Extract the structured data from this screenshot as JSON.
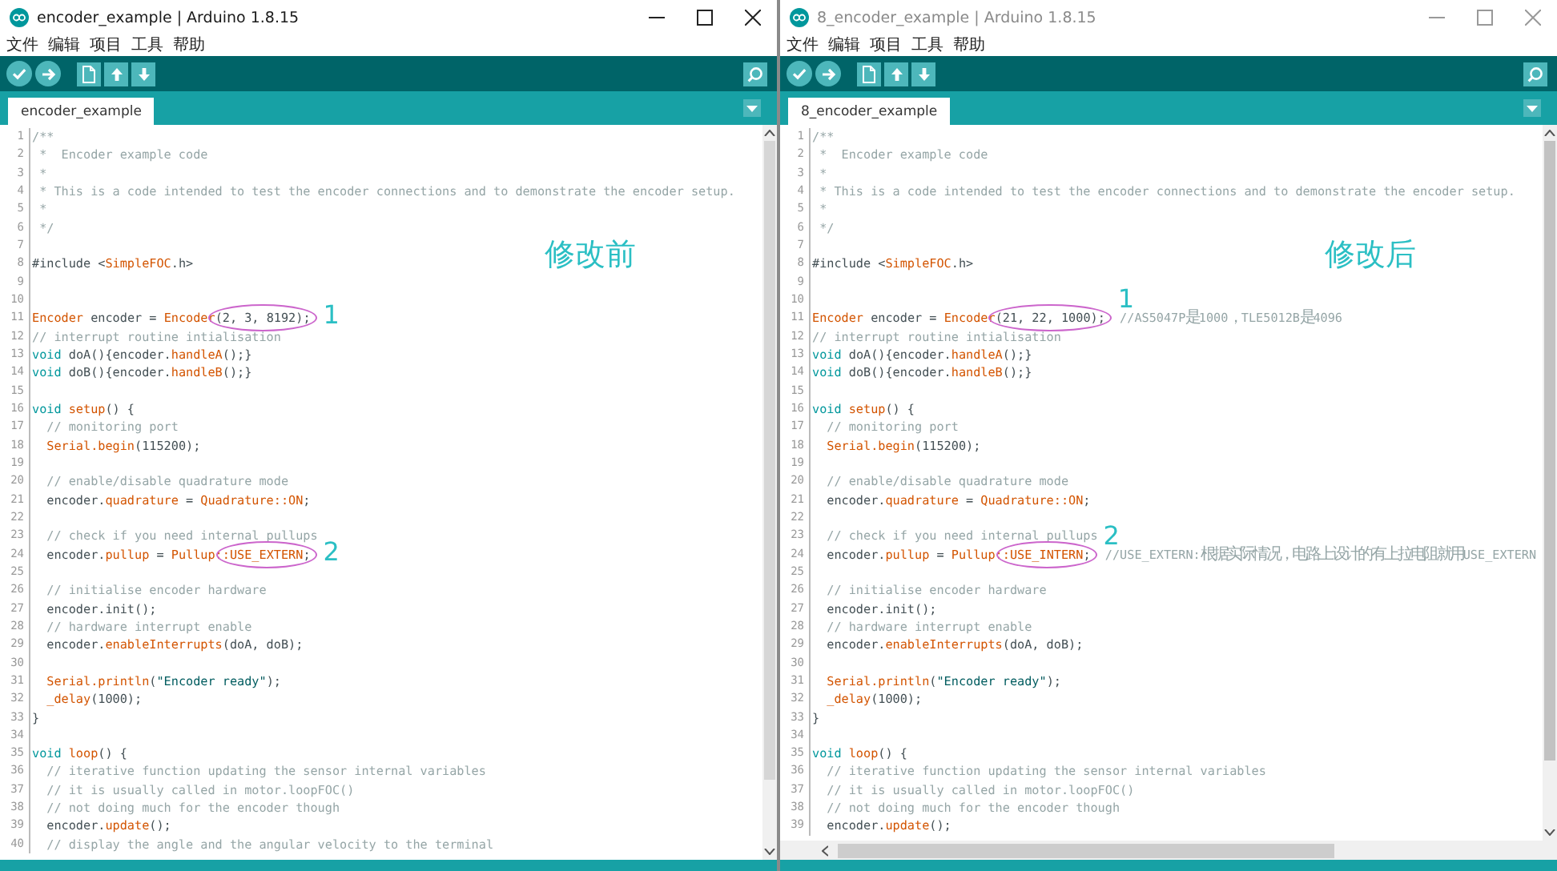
{
  "windows": [
    {
      "title": "encoder_example | Arduino 1.8.15",
      "active": true,
      "menu": [
        "文件",
        "编辑",
        "项目",
        "工具",
        "帮助"
      ],
      "tabs": [
        {
          "label": "encoder_example",
          "selected": true
        }
      ],
      "note": "修改前",
      "horizontal_scrollbar": false,
      "lines": [
        {
          "n": "1",
          "segs": [
            {
              "t": "/**",
              "kind": "cm"
            }
          ]
        },
        {
          "n": "2",
          "segs": [
            {
              "t": " *  Encoder example code",
              "kind": "cm"
            }
          ]
        },
        {
          "n": "3",
          "segs": [
            {
              "t": " *",
              "kind": "cm"
            }
          ]
        },
        {
          "n": "4",
          "segs": [
            {
              "t": " * This is a code intended to test the encoder connections and to demonstrate the encoder setup.",
              "kind": "cm"
            }
          ]
        },
        {
          "n": "5",
          "segs": [
            {
              "t": " *",
              "kind": "cm"
            }
          ]
        },
        {
          "n": "6",
          "segs": [
            {
              "t": " */",
              "kind": "cm"
            }
          ]
        },
        {
          "n": "7"
        },
        {
          "n": "8",
          "segs": [
            {
              "t": "#include <",
              "kind": "plain"
            },
            {
              "t": "SimpleFOC",
              "kind": "fn"
            },
            {
              "t": ".h>",
              "kind": "plain"
            }
          ]
        },
        {
          "n": "9"
        },
        {
          "n": "10"
        },
        {
          "n": "11",
          "mark": "1",
          "segs": [
            {
              "t": "Encoder",
              "kind": "fn"
            },
            {
              "t": " encoder = ",
              "kind": "plain"
            },
            {
              "t": "Encoder",
              "kind": "fn"
            },
            {
              "t": "(2, 3, 8192);",
              "kind": "plain",
              "circled": true
            }
          ]
        },
        {
          "n": "12",
          "segs": [
            {
              "t": "// interrupt routine intialisation",
              "kind": "cm"
            }
          ]
        },
        {
          "n": "13",
          "segs": [
            {
              "t": "void",
              "kind": "kw"
            },
            {
              "t": " doA(){encoder.",
              "kind": "plain"
            },
            {
              "t": "handleA",
              "kind": "fn"
            },
            {
              "t": "();}",
              "kind": "plain"
            }
          ]
        },
        {
          "n": "14",
          "segs": [
            {
              "t": "void",
              "kind": "kw"
            },
            {
              "t": " doB(){encoder.",
              "kind": "plain"
            },
            {
              "t": "handleB",
              "kind": "fn"
            },
            {
              "t": "();}",
              "kind": "plain"
            }
          ]
        },
        {
          "n": "15"
        },
        {
          "n": "16",
          "segs": [
            {
              "t": "void ",
              "kind": "kw"
            },
            {
              "t": "setup",
              "kind": "fn"
            },
            {
              "t": "() {",
              "kind": "plain"
            }
          ]
        },
        {
          "n": "17",
          "segs": [
            {
              "t": "  // monitoring port",
              "kind": "cm"
            }
          ]
        },
        {
          "n": "18",
          "segs": [
            {
              "t": "  Serial.begin",
              "kind": "fn"
            },
            {
              "t": "(115200);",
              "kind": "plain"
            }
          ]
        },
        {
          "n": "19"
        },
        {
          "n": "20",
          "segs": [
            {
              "t": "  // enable/disable quadrature mode",
              "kind": "cm"
            }
          ]
        },
        {
          "n": "21",
          "segs": [
            {
              "t": "  encoder.",
              "kind": "plain"
            },
            {
              "t": "quadrature",
              "kind": "fn"
            },
            {
              "t": " = ",
              "kind": "plain"
            },
            {
              "t": "Quadrature::ON",
              "kind": "fn"
            },
            {
              "t": ";",
              "kind": "plain"
            }
          ]
        },
        {
          "n": "22"
        },
        {
          "n": "23",
          "segs": [
            {
              "t": "  // check if you need internal pullups",
              "kind": "cm"
            }
          ]
        },
        {
          "n": "24",
          "mark": "2",
          "segs": [
            {
              "t": "  encoder.",
              "kind": "plain"
            },
            {
              "t": "pullup",
              "kind": "fn"
            },
            {
              "t": " = ",
              "kind": "plain"
            },
            {
              "t": "Pullup:",
              "kind": "fn"
            },
            {
              "t": ":USE_EXTERN",
              "kind": "fn",
              "circled": true
            },
            {
              "t": ";",
              "kind": "plain",
              "circled": true
            }
          ]
        },
        {
          "n": "25"
        },
        {
          "n": "26",
          "segs": [
            {
              "t": "  // initialise encoder hardware",
              "kind": "cm"
            }
          ]
        },
        {
          "n": "27",
          "segs": [
            {
              "t": "  encoder.init();",
              "kind": "plain"
            }
          ]
        },
        {
          "n": "28",
          "segs": [
            {
              "t": "  // hardware interrupt enable",
              "kind": "cm"
            }
          ]
        },
        {
          "n": "29",
          "segs": [
            {
              "t": "  encoder.",
              "kind": "plain"
            },
            {
              "t": "enableInterrupts",
              "kind": "fn"
            },
            {
              "t": "(doA, doB);",
              "kind": "plain"
            }
          ]
        },
        {
          "n": "30"
        },
        {
          "n": "31",
          "segs": [
            {
              "t": "  Serial.println",
              "kind": "fn"
            },
            {
              "t": "(",
              "kind": "plain"
            },
            {
              "t": "\"Encoder ready\"",
              "kind": "str"
            },
            {
              "t": ");",
              "kind": "plain"
            }
          ]
        },
        {
          "n": "32",
          "segs": [
            {
              "t": "  _delay",
              "kind": "fn"
            },
            {
              "t": "(1000);",
              "kind": "plain"
            }
          ]
        },
        {
          "n": "33",
          "segs": [
            {
              "t": "}",
              "kind": "plain"
            }
          ]
        },
        {
          "n": "34"
        },
        {
          "n": "35",
          "segs": [
            {
              "t": "void ",
              "kind": "kw"
            },
            {
              "t": "loop",
              "kind": "fn"
            },
            {
              "t": "() {",
              "kind": "plain"
            }
          ]
        },
        {
          "n": "36",
          "segs": [
            {
              "t": "  // iterative function updating the sensor internal variables",
              "kind": "cm"
            }
          ]
        },
        {
          "n": "37",
          "segs": [
            {
              "t": "  // it is usually called in motor.loopFOC()",
              "kind": "cm"
            }
          ]
        },
        {
          "n": "38",
          "segs": [
            {
              "t": "  // not doing much for the encoder though",
              "kind": "cm"
            }
          ]
        },
        {
          "n": "39",
          "segs": [
            {
              "t": "  encoder.",
              "kind": "plain"
            },
            {
              "t": "update",
              "kind": "fn"
            },
            {
              "t": "();",
              "kind": "plain"
            }
          ]
        },
        {
          "n": "40",
          "segs": [
            {
              "t": "  // display the angle and the angular velocity to the terminal",
              "kind": "cm"
            }
          ]
        }
      ]
    },
    {
      "title": "8_encoder_example | Arduino 1.8.15",
      "active": false,
      "menu": [
        "文件",
        "编辑",
        "项目",
        "工具",
        "帮助"
      ],
      "tabs": [
        {
          "label": "8_encoder_example",
          "selected": true
        }
      ],
      "note": "修改后",
      "horizontal_scrollbar": true,
      "lines": [
        {
          "n": "1",
          "segs": [
            {
              "t": "/**",
              "kind": "cm"
            }
          ]
        },
        {
          "n": "2",
          "segs": [
            {
              "t": " *  Encoder example code",
              "kind": "cm"
            }
          ]
        },
        {
          "n": "3",
          "segs": [
            {
              "t": " *",
              "kind": "cm"
            }
          ]
        },
        {
          "n": "4",
          "segs": [
            {
              "t": " * This is a code intended to test the encoder connections and to demonstrate the encoder setup.",
              "kind": "cm"
            }
          ]
        },
        {
          "n": "5",
          "segs": [
            {
              "t": " *",
              "kind": "cm"
            }
          ]
        },
        {
          "n": "6",
          "segs": [
            {
              "t": " */",
              "kind": "cm"
            }
          ]
        },
        {
          "n": "7"
        },
        {
          "n": "8",
          "segs": [
            {
              "t": "#include <",
              "kind": "plain"
            },
            {
              "t": "SimpleFOC",
              "kind": "fn"
            },
            {
              "t": ".h>",
              "kind": "plain"
            }
          ]
        },
        {
          "n": "9"
        },
        {
          "n": "10"
        },
        {
          "n": "11",
          "mark": "1",
          "segs": [
            {
              "t": "Encoder",
              "kind": "fn"
            },
            {
              "t": " encoder = ",
              "kind": "plain"
            },
            {
              "t": "Encoder",
              "kind": "fn"
            },
            {
              "t": "(21, 22, 1000);",
              "kind": "plain",
              "circled": true
            },
            {
              "t": "  //AS5047P",
              "kind": "cm"
            },
            {
              "t": "是",
              "kind": "cjk"
            },
            {
              "t": "1000",
              "kind": "cm"
            },
            {
              "t": "，",
              "kind": "cjk"
            },
            {
              "t": "TLE5012B",
              "kind": "cm"
            },
            {
              "t": "是",
              "kind": "cjk"
            },
            {
              "t": "4096",
              "kind": "cm"
            }
          ]
        },
        {
          "n": "12",
          "segs": [
            {
              "t": "// interrupt routine intialisation",
              "kind": "cm"
            }
          ]
        },
        {
          "n": "13",
          "segs": [
            {
              "t": "void",
              "kind": "kw"
            },
            {
              "t": " doA(){encoder.",
              "kind": "plain"
            },
            {
              "t": "handleA",
              "kind": "fn"
            },
            {
              "t": "();}",
              "kind": "plain"
            }
          ]
        },
        {
          "n": "14",
          "segs": [
            {
              "t": "void",
              "kind": "kw"
            },
            {
              "t": " doB(){encoder.",
              "kind": "plain"
            },
            {
              "t": "handleB",
              "kind": "fn"
            },
            {
              "t": "();}",
              "kind": "plain"
            }
          ]
        },
        {
          "n": "15"
        },
        {
          "n": "16",
          "segs": [
            {
              "t": "void ",
              "kind": "kw"
            },
            {
              "t": "setup",
              "kind": "fn"
            },
            {
              "t": "() {",
              "kind": "plain"
            }
          ]
        },
        {
          "n": "17",
          "segs": [
            {
              "t": "  // monitoring port",
              "kind": "cm"
            }
          ]
        },
        {
          "n": "18",
          "segs": [
            {
              "t": "  Serial.begin",
              "kind": "fn"
            },
            {
              "t": "(115200);",
              "kind": "plain"
            }
          ]
        },
        {
          "n": "19"
        },
        {
          "n": "20",
          "segs": [
            {
              "t": "  // enable/disable quadrature mode",
              "kind": "cm"
            }
          ]
        },
        {
          "n": "21",
          "segs": [
            {
              "t": "  encoder.",
              "kind": "plain"
            },
            {
              "t": "quadrature",
              "kind": "fn"
            },
            {
              "t": " = ",
              "kind": "plain"
            },
            {
              "t": "Quadrature::ON",
              "kind": "fn"
            },
            {
              "t": ";",
              "kind": "plain"
            }
          ]
        },
        {
          "n": "22"
        },
        {
          "n": "23",
          "segs": [
            {
              "t": "  // check if you need internal pullups",
              "kind": "cm"
            }
          ]
        },
        {
          "n": "24",
          "mark": "2",
          "segs": [
            {
              "t": "  encoder.",
              "kind": "plain"
            },
            {
              "t": "pullup",
              "kind": "fn"
            },
            {
              "t": " = ",
              "kind": "plain"
            },
            {
              "t": "Pullup:",
              "kind": "fn"
            },
            {
              "t": ":USE_INTERN",
              "kind": "fn",
              "circled": true
            },
            {
              "t": ";",
              "kind": "plain",
              "circled": true
            },
            {
              "t": "  //USE_EXTERN:",
              "kind": "cm"
            },
            {
              "t": "根据实际情况，电路上设计的有上拉电阻就用",
              "kind": "cjk"
            },
            {
              "t": "USE_EXTERN",
              "kind": "cm"
            }
          ]
        },
        {
          "n": "25"
        },
        {
          "n": "26",
          "segs": [
            {
              "t": "  // initialise encoder hardware",
              "kind": "cm"
            }
          ]
        },
        {
          "n": "27",
          "segs": [
            {
              "t": "  encoder.init();",
              "kind": "plain"
            }
          ]
        },
        {
          "n": "28",
          "segs": [
            {
              "t": "  // hardware interrupt enable",
              "kind": "cm"
            }
          ]
        },
        {
          "n": "29",
          "segs": [
            {
              "t": "  encoder.",
              "kind": "plain"
            },
            {
              "t": "enableInterrupts",
              "kind": "fn"
            },
            {
              "t": "(doA, doB);",
              "kind": "plain"
            }
          ]
        },
        {
          "n": "30"
        },
        {
          "n": "31",
          "segs": [
            {
              "t": "  Serial.println",
              "kind": "fn"
            },
            {
              "t": "(",
              "kind": "plain"
            },
            {
              "t": "\"Encoder ready\"",
              "kind": "str"
            },
            {
              "t": ");",
              "kind": "plain"
            }
          ]
        },
        {
          "n": "32",
          "segs": [
            {
              "t": "  _delay",
              "kind": "fn"
            },
            {
              "t": "(1000);",
              "kind": "plain"
            }
          ]
        },
        {
          "n": "33",
          "segs": [
            {
              "t": "}",
              "kind": "plain"
            }
          ]
        },
        {
          "n": "34"
        },
        {
          "n": "35",
          "segs": [
            {
              "t": "void ",
              "kind": "kw"
            },
            {
              "t": "loop",
              "kind": "fn"
            },
            {
              "t": "() {",
              "kind": "plain"
            }
          ]
        },
        {
          "n": "36",
          "segs": [
            {
              "t": "  // iterative function updating the sensor internal variables",
              "kind": "cm"
            }
          ]
        },
        {
          "n": "37",
          "segs": [
            {
              "t": "  // it is usually called in motor.loopFOC()",
              "kind": "cm"
            }
          ]
        },
        {
          "n": "38",
          "segs": [
            {
              "t": "  // not doing much for the encoder though",
              "kind": "cm"
            }
          ]
        },
        {
          "n": "39",
          "segs": [
            {
              "t": "  encoder.",
              "kind": "plain"
            },
            {
              "t": "update",
              "kind": "fn"
            },
            {
              "t": "();",
              "kind": "plain"
            }
          ]
        }
      ]
    }
  ]
}
